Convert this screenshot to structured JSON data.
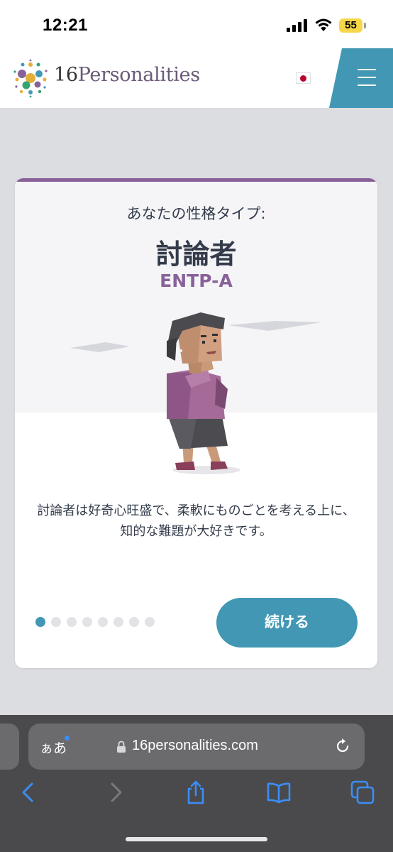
{
  "status": {
    "time": "12:21",
    "battery": "55"
  },
  "site": {
    "logo_number": "16",
    "logo_word": "Personalities"
  },
  "card": {
    "intro": "あなたの性格タイプ:",
    "type_name": "討論者",
    "type_code": "ENTP-A",
    "description": "討論者は好奇心旺盛で、柔軟にものごとを考える上に、知的な難題が大好きです。",
    "continue_label": "続ける",
    "pager": {
      "total": 8,
      "active": 1
    }
  },
  "browser": {
    "text_size_label": "ぁあ",
    "url": "16personalities.com"
  },
  "colors": {
    "accent_blue": "#4298b4",
    "analyst_purple": "#88619a",
    "text_dark": "#343c4b"
  },
  "icons": [
    "signal-icon",
    "wifi-icon",
    "battery-icon",
    "logo-mark-icon",
    "japan-flag-icon",
    "hamburger-menu-icon",
    "lock-icon",
    "reload-icon",
    "back-icon",
    "forward-icon",
    "share-icon",
    "bookmarks-icon",
    "tabs-icon"
  ]
}
